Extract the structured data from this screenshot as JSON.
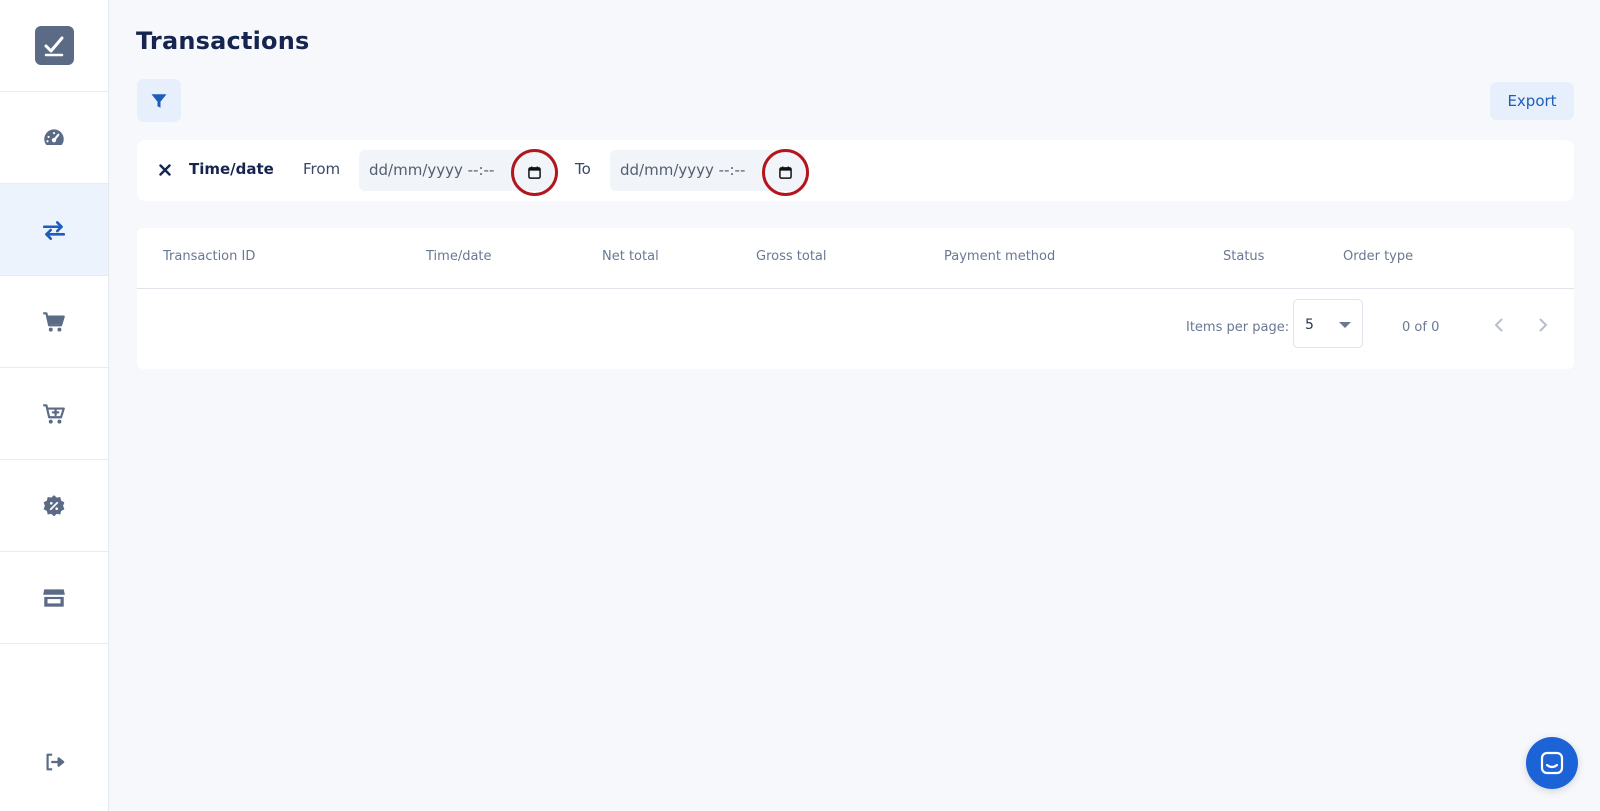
{
  "page": {
    "title": "Transactions"
  },
  "toolbar": {
    "filter_icon": "filter-icon",
    "export_label": "Export"
  },
  "filter": {
    "field_label": "Time/date",
    "from_label": "From",
    "to_label": "To",
    "from_value": "dd/mm/yyyy --:--",
    "to_value": "dd/mm/yyyy --:--"
  },
  "table": {
    "columns": [
      "Transaction ID",
      "Time/date",
      "Net total",
      "Gross total",
      "Payment method",
      "Status",
      "Order type"
    ],
    "rows": []
  },
  "paginator": {
    "items_per_page_label": "Items per page:",
    "items_per_page": "5",
    "range_label": "0 of 0"
  },
  "sidebar": {
    "items": [
      {
        "icon": "dashboard-gauge-icon",
        "active": false
      },
      {
        "icon": "transactions-arrows-icon",
        "active": true
      },
      {
        "icon": "cart-icon",
        "active": false
      },
      {
        "icon": "cart-plus-icon",
        "active": false
      },
      {
        "icon": "discount-badge-icon",
        "active": false
      },
      {
        "icon": "store-icon",
        "active": false
      }
    ],
    "logout_icon": "logout-icon"
  },
  "colors": {
    "accent": "#1e5dbb",
    "nav_icon": "#5b6b86",
    "active_bg": "#edf3fc",
    "highlight_ring": "#b3151c",
    "chat_button": "#1c63d8"
  }
}
